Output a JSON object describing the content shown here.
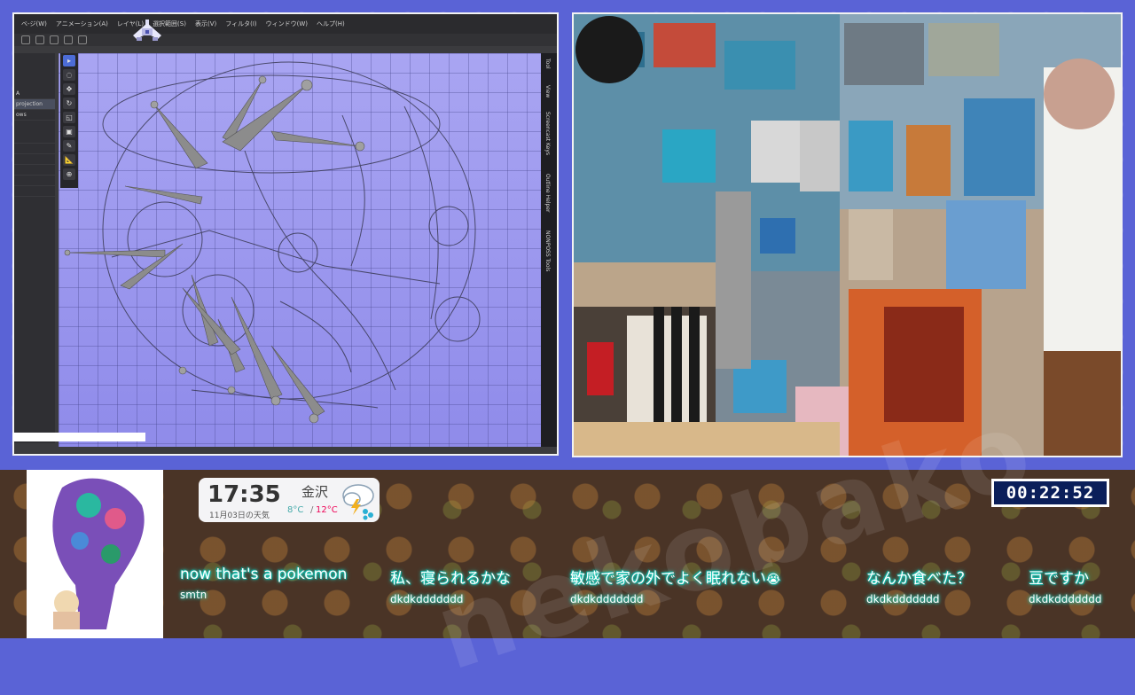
{
  "drawing_app": {
    "menu": [
      "ベ-ジ(W)",
      "アニメーション(A)",
      "レイヤ(L)",
      "選択範囲(S)",
      "表示(V)",
      "フィルタ(I)",
      "ウィンドウ(W)",
      "ヘルプ(H)"
    ],
    "layers_panel": [
      "A",
      "projection",
      "ows",
      "",
      "",
      "",
      "",
      "",
      ""
    ],
    "side_tabs": [
      "Tool",
      "View",
      "Screencast Keys",
      "Outline Helper",
      "NONPOSS Tools"
    ]
  },
  "weather": {
    "time": "17:35",
    "date": "11月03日の天気",
    "city": "金沢",
    "low": "8°C",
    "sep": "/",
    "high": "12°C",
    "icon": "rain-cloud-icon"
  },
  "timer": "00:22:52",
  "chat": [
    {
      "text": "now that's a pokemon",
      "user": "smtn"
    },
    {
      "text": "私、寝られるかな",
      "user": "dkdkddddddd"
    },
    {
      "text": "敏感で家の外でよく眠れない",
      "user": "dkdkddddddd",
      "emoji": "😭"
    },
    {
      "text": "なんか食べた？",
      "user": "dkdkddddddd"
    },
    {
      "text": "豆ですか",
      "user": "dkdkddddddd"
    }
  ],
  "colors": {
    "overlay_blue": "#5a63d6",
    "canvas_purple": "#a9a5f2",
    "bottom_brown": "#4a3426",
    "chat_glow": "#2ff0d8",
    "timer_bg": "#0b1f5a"
  }
}
